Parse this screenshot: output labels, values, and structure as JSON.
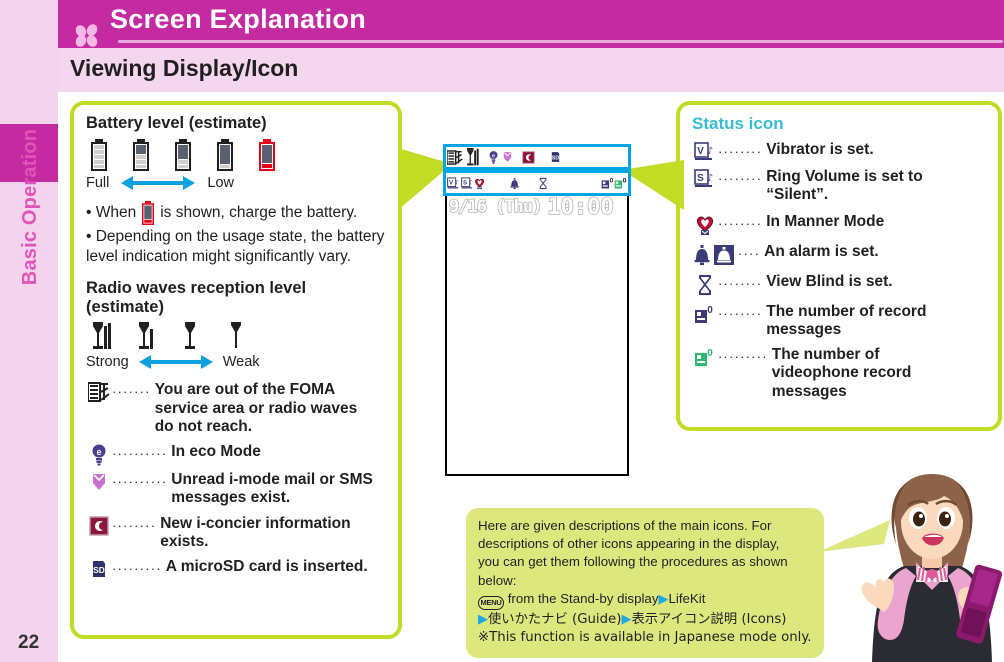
{
  "sidebar": {
    "section_label": "Basic Operation",
    "page_number": "22"
  },
  "header": {
    "title": "Screen Explanation",
    "subtitle": "Viewing Display/Icon",
    "icon": "clover-icon",
    "brand_color": "#c42ba0",
    "subheader_color": "#f4d6ef",
    "panel_border_color": "#c2dc26"
  },
  "battery": {
    "heading": "Battery level (estimate)",
    "levels": [
      {
        "icon": "battery-full-icon",
        "fill": 5
      },
      {
        "icon": "battery-high-icon",
        "fill": 4
      },
      {
        "icon": "battery-mid-icon",
        "fill": 3
      },
      {
        "icon": "battery-low-icon",
        "fill": 2
      },
      {
        "icon": "battery-empty-icon",
        "fill": 1
      }
    ],
    "scale_left": "Full",
    "scale_right": "Low",
    "bullets": [
      {
        "pre": "• When",
        "post": "is shown, charge the battery.",
        "icon": "battery-empty-icon"
      },
      {
        "text": "• Depending on the usage state, the battery level indication might significantly vary."
      }
    ]
  },
  "radio": {
    "heading_line1": "Radio waves reception level",
    "heading_line2": "(estimate)",
    "levels": [
      {
        "icon": "antenna-3bar-icon",
        "bars": 3
      },
      {
        "icon": "antenna-2bar-icon",
        "bars": 2
      },
      {
        "icon": "antenna-1bar-icon",
        "bars": 1
      },
      {
        "icon": "antenna-0bar-icon",
        "bars": 0
      }
    ],
    "scale_left": "Strong",
    "scale_right": "Weak"
  },
  "left_list": [
    {
      "icon": "out-of-service-area-icon",
      "dots": "·······",
      "text": "You are out of the FOMA service area or radio waves do not reach."
    },
    {
      "icon": "eco-mode-icon",
      "dots": "··········",
      "text": "In eco Mode"
    },
    {
      "icon": "unread-mail-icon",
      "dots": "··········",
      "text": "Unread i-mode mail or SMS messages exist."
    },
    {
      "icon": "i-concier-icon",
      "dots": "········",
      "text": "New i-concier information exists."
    },
    {
      "icon": "microsd-icon",
      "dots": "·········",
      "text": "A microSD card is inserted."
    }
  ],
  "status_panel": {
    "heading": "Status icon",
    "items": [
      {
        "icons": [
          "vibrator-icon"
        ],
        "dots": "········",
        "text": "Vibrator is set."
      },
      {
        "icons": [
          "silent-ring-volume-icon"
        ],
        "dots": "········",
        "text": "Ring Volume is set to “Silent”."
      },
      {
        "icons": [
          "manner-mode-icon"
        ],
        "dots": "········",
        "text": "In Manner Mode"
      },
      {
        "icons": [
          "alarm-bell-icon",
          "alarm-bell-outline-icon"
        ],
        "dots": "····",
        "text": "An alarm is set."
      },
      {
        "icons": [
          "view-blind-icon"
        ],
        "dots": "········",
        "text": "View Blind is set."
      },
      {
        "icons": [
          "record-message-icon"
        ],
        "dots": "········",
        "text": "The number of record messages"
      },
      {
        "icons": [
          "videophone-record-icon"
        ],
        "dots": "·········",
        "text": "The number of videophone record messages"
      }
    ]
  },
  "phone_display": {
    "status_row_1": [
      "out-of-service-area-icon",
      "antenna-3bar-icon",
      "eco-mode-icon",
      "unread-mail-icon",
      "i-concier-icon",
      "microsd-icon"
    ],
    "status_row_2": [
      "vibrator-icon",
      "silent-ring-volume-icon",
      "manner-mode-icon",
      "alarm-bell-icon",
      "view-blind-icon",
      "record-message-icon",
      "videophone-record-icon"
    ],
    "date": "9/16 (Thu)",
    "time": "10:00",
    "record_message_count": "0",
    "videophone_record_count": "0",
    "highlight_color": "#00a5e3"
  },
  "callout": {
    "line1": "Here are given descriptions of the main icons. For",
    "line2": "descriptions of other icons appearing in the display,",
    "line3": "you can get them following the procedures as shown",
    "line4": "below:",
    "menu_key": "MENU",
    "step_text_1": "from the Stand-by display",
    "step_text_2": "LifeKit",
    "step_text_3": "使いかたナビ (Guide)",
    "step_text_4": "表示アイコン説明 (Icons)",
    "note": "※This function is available in Japanese mode only.",
    "bubble_color": "#dce87e"
  },
  "character": {
    "icon": "woman-with-phone-illustration"
  }
}
